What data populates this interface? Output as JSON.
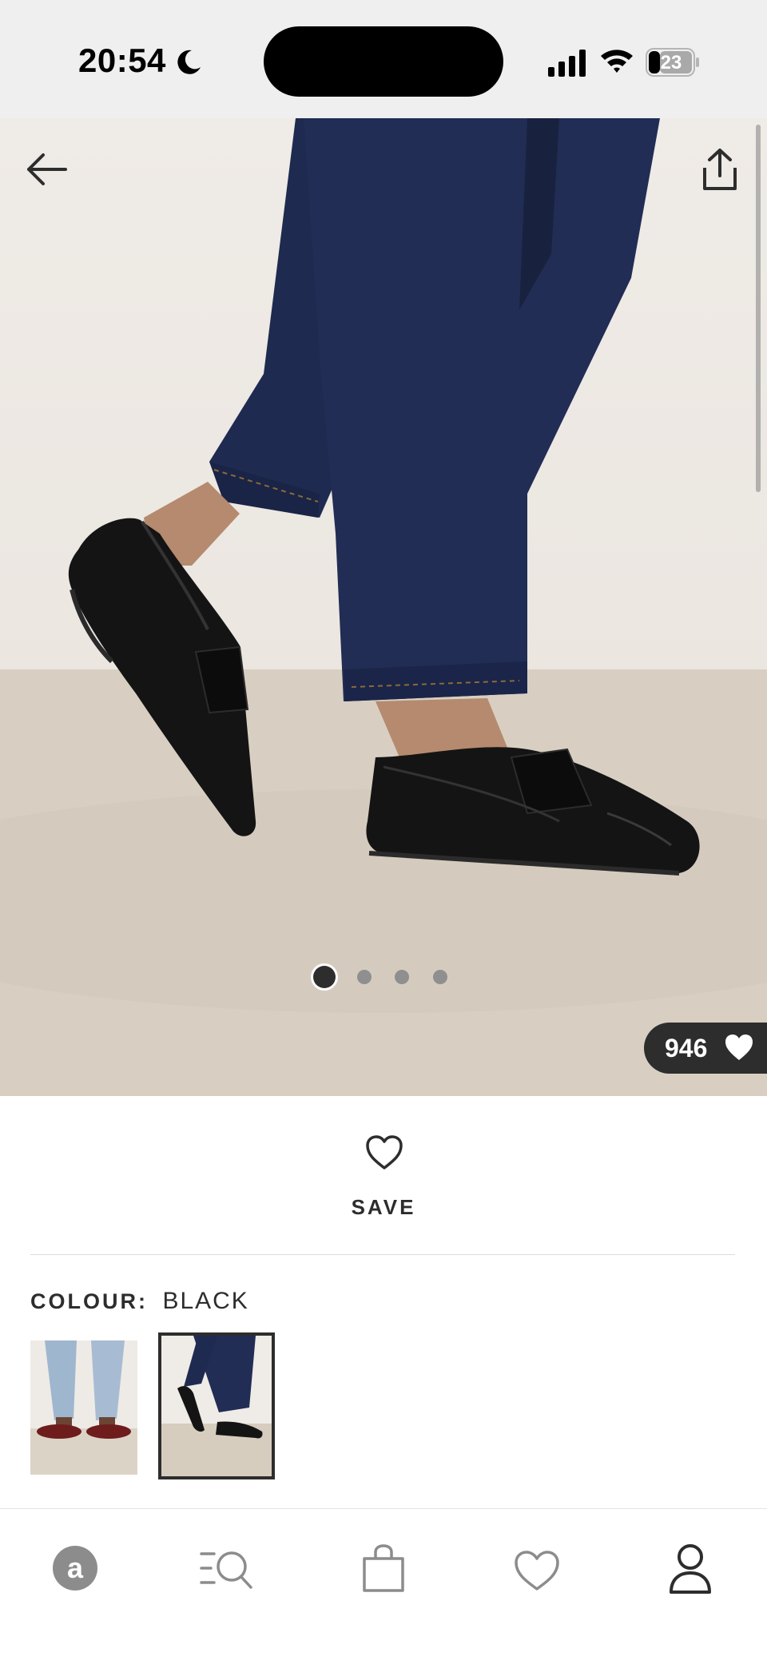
{
  "status_bar": {
    "time": "20:54",
    "battery": "23",
    "icons": [
      "moon-icon",
      "signal-icon",
      "wifi-icon",
      "battery-icon"
    ]
  },
  "product_image": {
    "carousel": {
      "total": 4,
      "active_index": 1
    },
    "save_count": "946",
    "icons": [
      "back-arrow-icon",
      "share-icon",
      "heart-filled-icon"
    ]
  },
  "save": {
    "label": "SAVE",
    "icon": "heart-outline-icon"
  },
  "colour": {
    "label": "COLOUR:",
    "value": "BLACK",
    "selected_swatch": 2,
    "swatch_count": 2
  },
  "bottom_nav": {
    "items": [
      "asos-home-icon",
      "search-icon",
      "bag-icon",
      "saved-items-icon",
      "account-icon"
    ]
  },
  "colors": {
    "dark": "#2d2d2d",
    "denim": "#1f2a4e",
    "leather": "#141414",
    "backdrop": "#efebe6",
    "floor": "#d6cdbf"
  }
}
